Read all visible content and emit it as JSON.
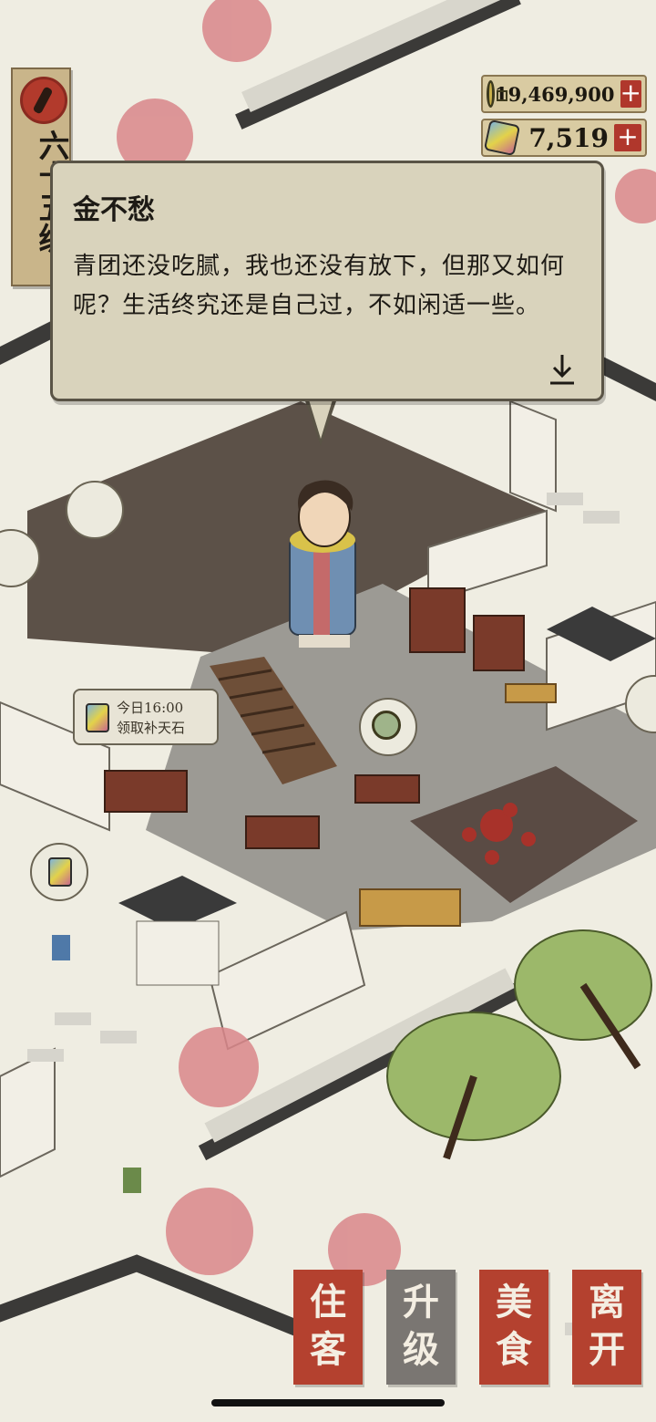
{
  "level": {
    "text": "六十五级"
  },
  "currency": {
    "coins": {
      "value": "19,469,900",
      "icon": "copper-coin-icon"
    },
    "gems": {
      "value": "7,519",
      "icon": "mending-stone-icon"
    },
    "plus_label": "+"
  },
  "dialog": {
    "speaker": "金不愁",
    "text": "青团还没吃腻，我也还没有放下，但那又如何呢？生活终究还是自己过，不如闲适一些。"
  },
  "reward_tag": {
    "line1": "今日16:00",
    "line2": "领取补天石"
  },
  "actions": [
    {
      "label": "住客",
      "style": "red"
    },
    {
      "label": "升级",
      "style": "gray"
    },
    {
      "label": "美食",
      "style": "red"
    },
    {
      "label": "离开",
      "style": "red"
    }
  ],
  "colors": {
    "accent_red": "#b4412f",
    "parchment": "#d9d3bc",
    "ground": "#efede2"
  }
}
